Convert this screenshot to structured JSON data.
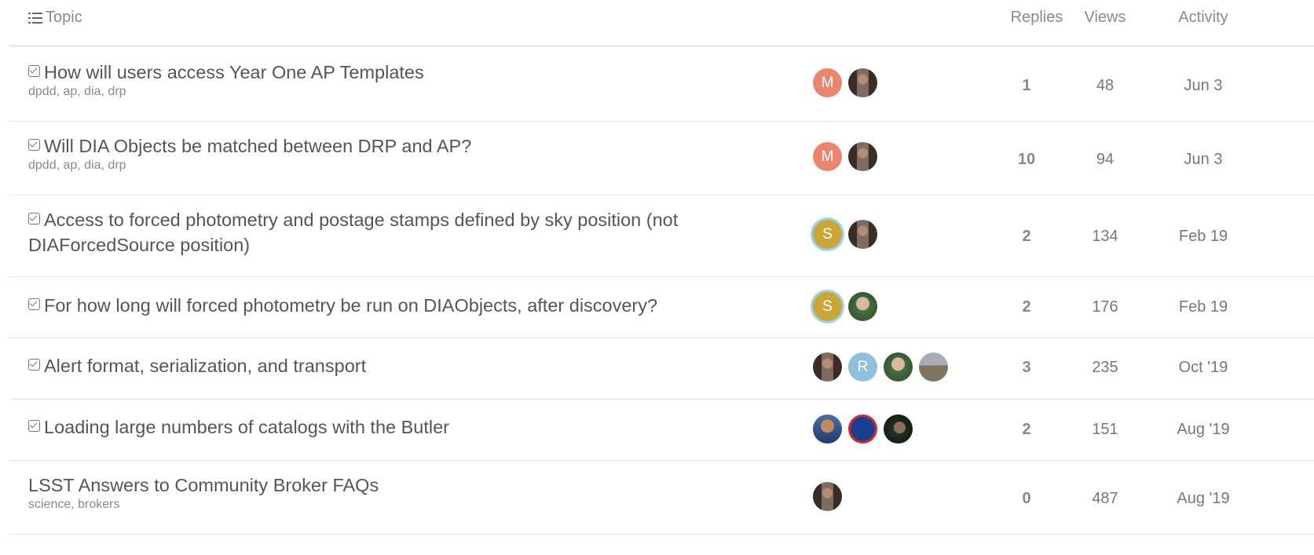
{
  "header": {
    "topic": "Topic",
    "replies": "Replies",
    "views": "Views",
    "activity": "Activity"
  },
  "rows": [
    {
      "title": "How will users access Year One AP Templates",
      "solved": true,
      "tags": "dpdd, ap, dia, drp",
      "avatars": [
        {
          "kind": "letter",
          "letter": "M",
          "color": "#e9876e"
        },
        {
          "kind": "photo",
          "style": "woman"
        }
      ],
      "replies": "1",
      "views": "48",
      "activity": "Jun 3"
    },
    {
      "title": "Will DIA Objects be matched between DRP and AP?",
      "solved": true,
      "tags": "dpdd, ap, dia, drp",
      "avatars": [
        {
          "kind": "letter",
          "letter": "M",
          "color": "#e9876e"
        },
        {
          "kind": "photo",
          "style": "woman"
        }
      ],
      "replies": "10",
      "views": "94",
      "activity": "Jun 3"
    },
    {
      "title": "Access to forced photometry and postage stamps defined by sky position (not DIAForcedSource position)",
      "solved": true,
      "tags": "",
      "avatars": [
        {
          "kind": "letter",
          "letter": "S",
          "color": "#c9a53a",
          "ring": true
        },
        {
          "kind": "photo",
          "style": "woman"
        }
      ],
      "replies": "2",
      "views": "134",
      "activity": "Feb 19"
    },
    {
      "title": "For how long will forced photometry be run on DIAObjects, after discovery?",
      "solved": true,
      "tags": "",
      "avatars": [
        {
          "kind": "letter",
          "letter": "S",
          "color": "#c9a53a",
          "ring": true
        },
        {
          "kind": "photo",
          "style": "man-green"
        }
      ],
      "replies": "2",
      "views": "176",
      "activity": "Feb 19"
    },
    {
      "title": "Alert format, serialization, and transport",
      "solved": true,
      "tags": "",
      "avatars": [
        {
          "kind": "photo",
          "style": "woman"
        },
        {
          "kind": "letter",
          "letter": "R",
          "color": "#8fc1de"
        },
        {
          "kind": "photo",
          "style": "man-green"
        },
        {
          "kind": "photo",
          "style": "landscape"
        }
      ],
      "replies": "3",
      "views": "235",
      "activity": "Oct '19"
    },
    {
      "title": "Loading large numbers of catalogs with the Butler",
      "solved": true,
      "tags": "",
      "avatars": [
        {
          "kind": "photo",
          "style": "blue"
        },
        {
          "kind": "photo",
          "style": "kl"
        },
        {
          "kind": "photo",
          "style": "dark"
        }
      ],
      "replies": "2",
      "views": "151",
      "activity": "Aug '19"
    },
    {
      "title": "LSST Answers to Community Broker FAQs",
      "solved": false,
      "tags": "science, brokers",
      "avatars": [
        {
          "kind": "photo",
          "style": "woman"
        }
      ],
      "replies": "0",
      "views": "487",
      "activity": "Aug '19"
    }
  ]
}
